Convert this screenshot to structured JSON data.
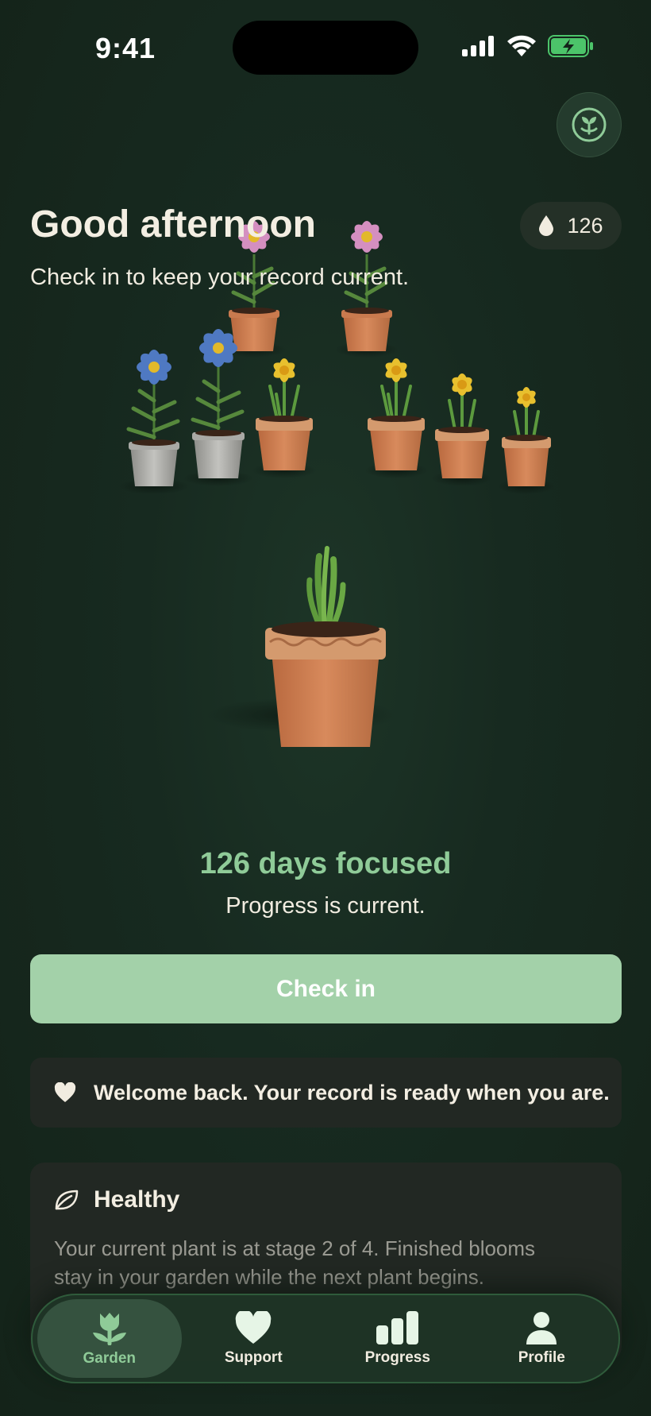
{
  "status_bar": {
    "time": "9:41"
  },
  "header": {
    "greeting": "Good afternoon",
    "subtitle": "Check in to keep your record current.",
    "drops": {
      "icon": "water-drop-icon",
      "count": "126"
    },
    "avatar_icon": "sprout-icon"
  },
  "progress": {
    "days_text": "126 days focused",
    "status_text": "Progress is current."
  },
  "checkin": {
    "label": "Check in"
  },
  "welcome": {
    "icon": "heart-icon",
    "text": "Welcome back. Your record is ready when you are."
  },
  "health": {
    "icon": "leaf-icon",
    "title": "Healthy",
    "description": "Your current plant is at stage 2 of 4. Finished blooms stay in your garden while the next plant begins."
  },
  "tabs": [
    {
      "label": "Garden",
      "icon": "tulip-icon",
      "active": true
    },
    {
      "label": "Support",
      "icon": "heart-icon",
      "active": false
    },
    {
      "label": "Progress",
      "icon": "bar-chart-icon",
      "active": false
    },
    {
      "label": "Profile",
      "icon": "person-icon",
      "active": false
    }
  ],
  "colors": {
    "accent": "#8fcb98",
    "button": "#a3d1a9",
    "background": "#172a20",
    "card": "#222823"
  }
}
